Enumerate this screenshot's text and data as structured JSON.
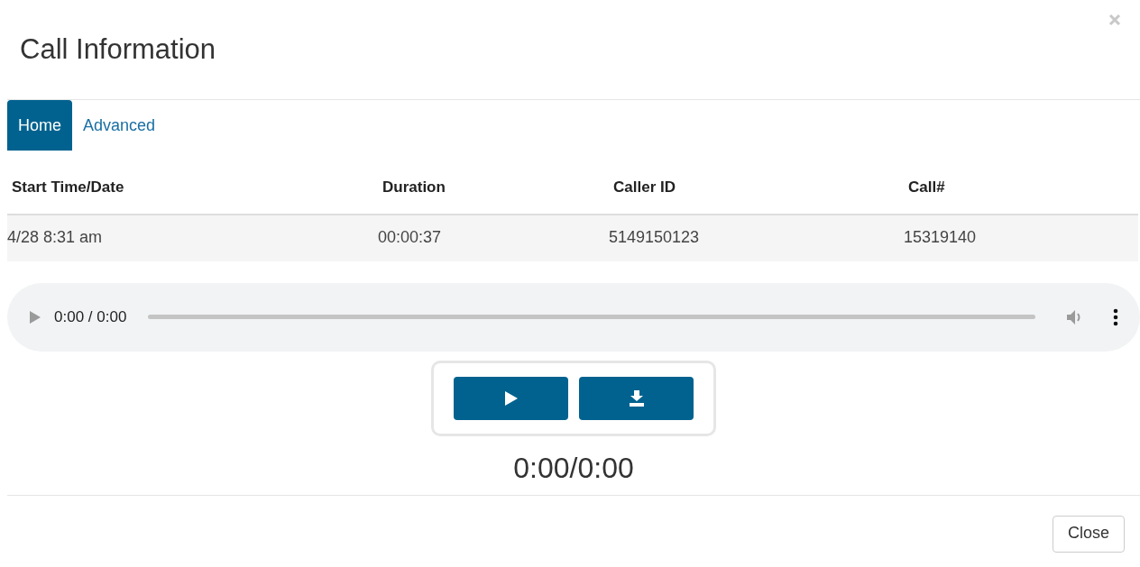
{
  "dialog": {
    "title": "Call Information"
  },
  "tabs": [
    {
      "label": "Home",
      "selected": true
    },
    {
      "label": "Advanced",
      "selected": false
    }
  ],
  "table": {
    "columns": [
      "Start Time/Date",
      "Duration",
      "Caller ID",
      "Call#"
    ],
    "rows": [
      [
        "4/28 8:31 am",
        "00:00:37",
        "5149150123",
        "15319140"
      ]
    ]
  },
  "audio_player": {
    "time": "0:00 / 0:00",
    "level": 0
  },
  "playback_time": "0:00/0:00",
  "footer": {
    "buttons": [
      "Close"
    ]
  }
}
